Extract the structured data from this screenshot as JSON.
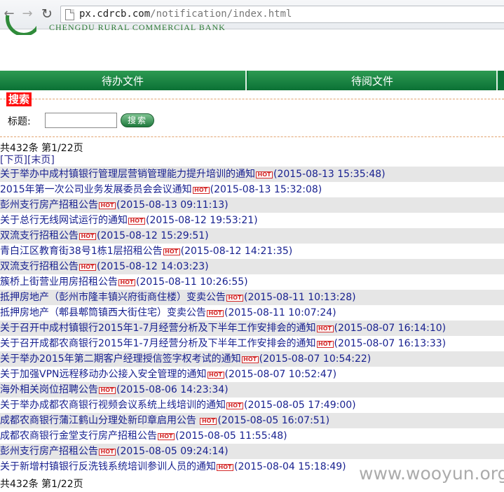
{
  "browser": {
    "url_host": "px.cdrcb.com",
    "url_path": "/notification/index.html"
  },
  "bank": {
    "name": "CHENGDU RURAL COMMERCIAL BANK"
  },
  "tabs": [
    {
      "label": "待办文件"
    },
    {
      "label": "待阅文件"
    }
  ],
  "search": {
    "heading": "搜索",
    "title_label": "标题:",
    "input_value": "",
    "button_label": "搜索"
  },
  "pager": {
    "summary": "共432条  第1/22页",
    "next": "[下页]",
    "last": "[末页]"
  },
  "hot_label": "HOT",
  "notices": [
    {
      "title": "关于举办中成村镇银行管理层营销管理能力提升培训的通知",
      "date": "(2015-08-13 15:35:48)"
    },
    {
      "title": "2015年第一次公司业务发展委员会会议通知",
      "date": "(2015-08-13 15:32:08)"
    },
    {
      "title": "彭州支行房产招租公告",
      "date": "(2015-08-13 09:11:13)"
    },
    {
      "title": "关于总行无线网试运行的通知",
      "date": "(2015-08-12 19:53:21)"
    },
    {
      "title": "双流支行招租公告",
      "date": "(2015-08-12 15:29:51)"
    },
    {
      "title": "青白江区教育街38号1栋1层招租公告",
      "date": "(2015-08-12 14:21:35)"
    },
    {
      "title": "双流支行招租公告",
      "date": "(2015-08-12 14:03:23)"
    },
    {
      "title": "簇桥上街营业用房招租公告",
      "date": "(2015-08-11 10:26:55)"
    },
    {
      "title": "抵押房地产（彭州市隆丰镇兴府街商住楼）变卖公告",
      "date": "(2015-08-11 10:13:28)"
    },
    {
      "title": "抵押房地产（郫县郫筒镇西大街住宅）变卖公告",
      "date": "(2015-08-11 10:07:24)"
    },
    {
      "title": "关于召开中成村镇银行2015年1-7月经营分析及下半年工作安排会的通知",
      "date": "(2015-08-07 16:14:10)"
    },
    {
      "title": "关于召开成都农商银行2015年1-7月经营分析及下半年工作安排会的通知",
      "date": "(2015-08-07 16:13:33)"
    },
    {
      "title": "关于举办2015年第二期客户经理授信签字权考试的通知",
      "date": "(2015-08-07 10:54:22)"
    },
    {
      "title": "关于加强VPN远程移动办公接入安全管理的通知",
      "date": "(2015-08-07 10:52:47)"
    },
    {
      "title": "海外相关岗位招聘公告",
      "date": "(2015-08-06 14:23:34)"
    },
    {
      "title": "关于举办成都农商银行视频会议系统上线培训的通知",
      "date": "(2015-08-05 17:49:00)"
    },
    {
      "title": "成都农商银行蒲江鹤山分理处新印章启用公告 ",
      "date": "(2015-08-05 16:07:51)"
    },
    {
      "title": "成都农商银行金堂支行房产招租公告",
      "date": "(2015-08-05 11:55:48)"
    },
    {
      "title": "彭州支行房产招租公告",
      "date": "(2015-08-05 09:24:14)"
    },
    {
      "title": "关于新增村镇银行反洗钱系统培训参训人员的通知",
      "date": "(2015-08-04 15:18:49)"
    }
  ],
  "watermark": "www.wooyun.org"
}
